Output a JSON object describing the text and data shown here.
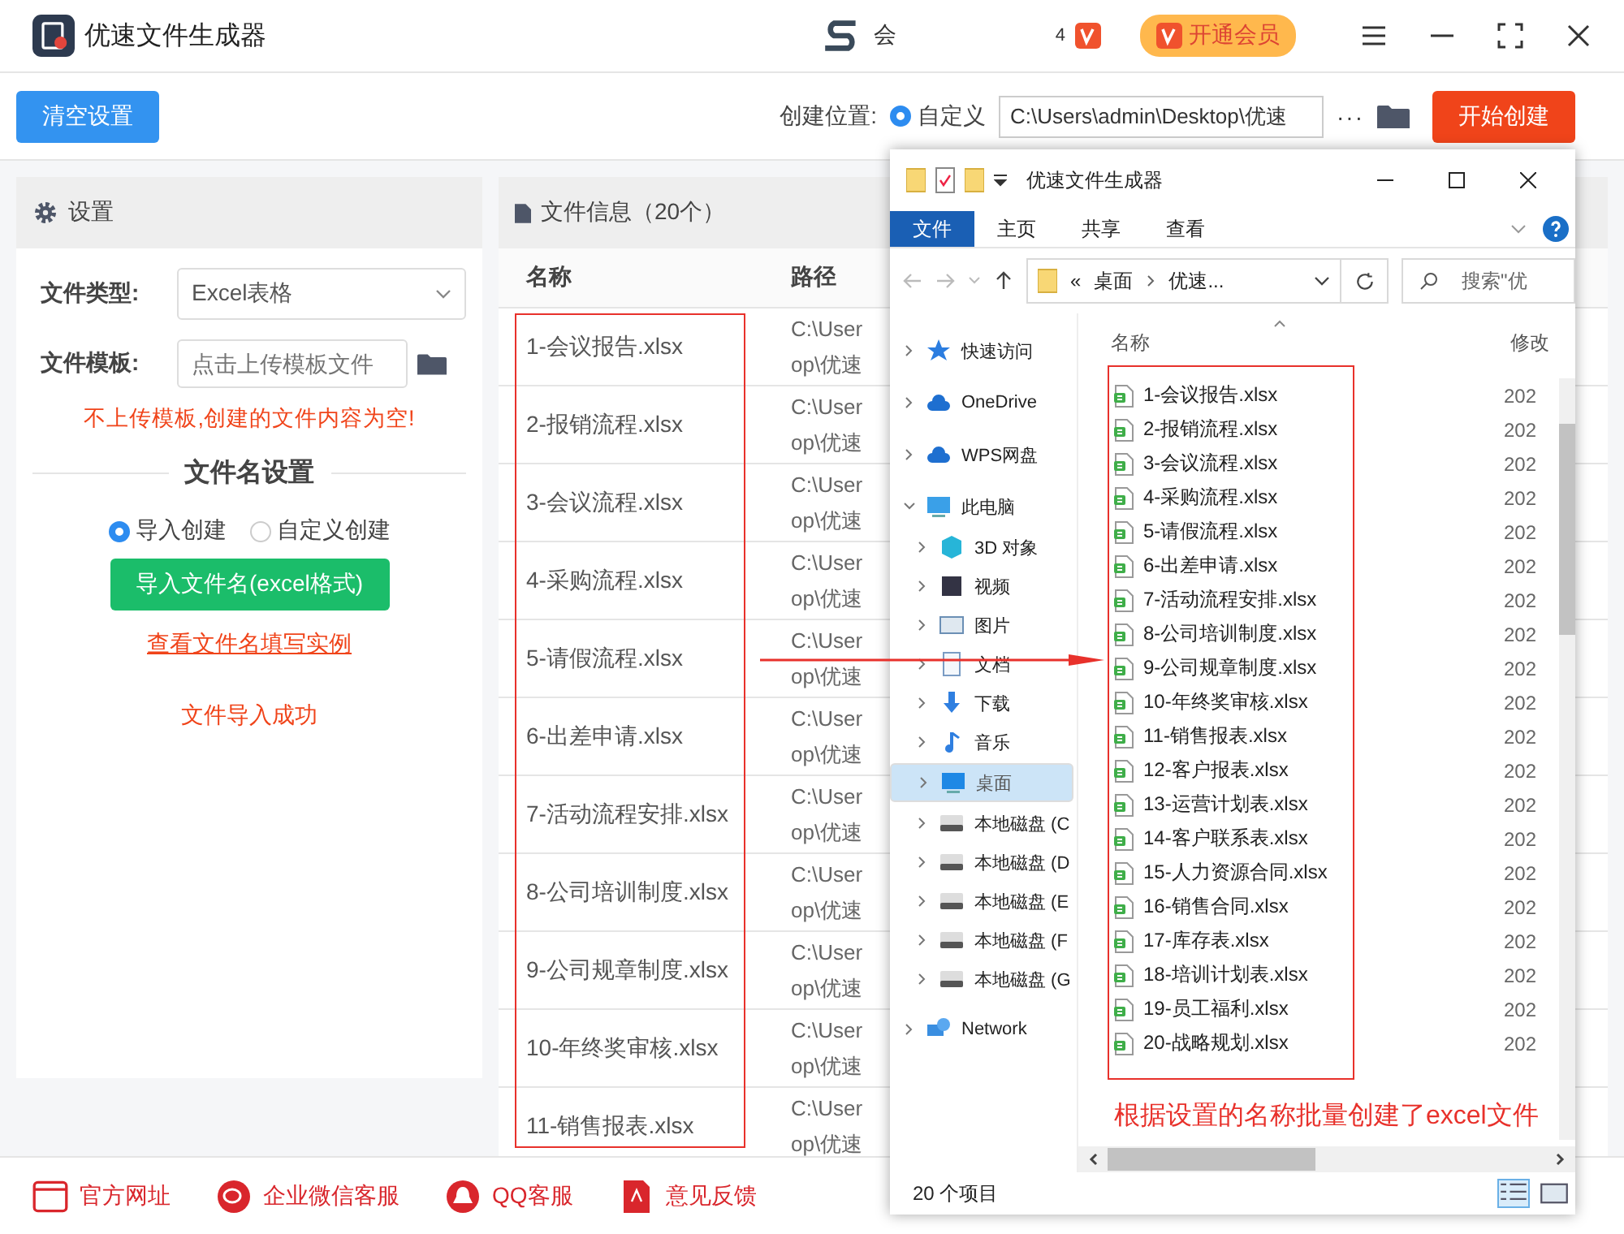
{
  "app": {
    "title": "优速文件生成器",
    "promo_text": "会",
    "promo_num": "4",
    "vip_button": "开通会员"
  },
  "toolbar": {
    "clear_button": "清空设置",
    "location_label": "创建位置:",
    "location_radio": {
      "label": "自定义",
      "selected": true
    },
    "path_value": "C:\\Users\\admin\\Desktop\\优速",
    "more": "···",
    "start_button": "开始创建"
  },
  "settings": {
    "title": "设置",
    "type_label": "文件类型:",
    "type_value": "Excel表格",
    "template_label": "文件模板:",
    "template_placeholder": "点击上传模板文件",
    "warning": "不上传模板,创建的文件内容为空!",
    "section_title": "文件名设置",
    "modes": [
      {
        "label": "导入创建",
        "selected": true
      },
      {
        "label": "自定义创建",
        "selected": false
      }
    ],
    "import_button": "导入文件名(excel格式)",
    "example_link": "查看文件名填写实例",
    "status": "文件导入成功"
  },
  "file_info": {
    "title": "文件信息（20个）",
    "columns": [
      "名称",
      "路径"
    ],
    "rows": [
      {
        "name": "1-会议报告.xlsx",
        "path": [
          "C:\\User",
          "op\\优速"
        ]
      },
      {
        "name": "2-报销流程.xlsx",
        "path": [
          "C:\\User",
          "op\\优速"
        ]
      },
      {
        "name": "3-会议流程.xlsx",
        "path": [
          "C:\\User",
          "op\\优速"
        ]
      },
      {
        "name": "4-采购流程.xlsx",
        "path": [
          "C:\\User",
          "op\\优速"
        ]
      },
      {
        "name": "5-请假流程.xlsx",
        "path": [
          "C:\\User",
          "op\\优速"
        ]
      },
      {
        "name": "6-出差申请.xlsx",
        "path": [
          "C:\\User",
          "op\\优速"
        ]
      },
      {
        "name": "7-活动流程安排.xlsx",
        "path": [
          "C:\\User",
          "op\\优速"
        ]
      },
      {
        "name": "8-公司培训制度.xlsx",
        "path": [
          "C:\\User",
          "op\\优速"
        ]
      },
      {
        "name": "9-公司规章制度.xlsx",
        "path": [
          "C:\\User",
          "op\\优速"
        ]
      },
      {
        "name": "10-年终奖审核.xlsx",
        "path": [
          "C:\\User",
          "op\\优速"
        ]
      },
      {
        "name": "11-销售报表.xlsx",
        "path": [
          "C:\\User",
          "op\\优速"
        ]
      }
    ]
  },
  "footer": [
    {
      "kind": "web",
      "label": "官方网址"
    },
    {
      "kind": "chat",
      "label": "企业微信客服"
    },
    {
      "kind": "qq",
      "label": "QQ客服"
    },
    {
      "kind": "feedback",
      "label": "意见反馈"
    }
  ],
  "explorer": {
    "title": "优速文件生成器",
    "ribbon_tabs": [
      {
        "label": "文件",
        "selected": true
      },
      {
        "label": "主页",
        "selected": false
      },
      {
        "label": "共享",
        "selected": false
      },
      {
        "label": "查看",
        "selected": false
      }
    ],
    "breadcrumb": [
      "«",
      "桌面",
      "优速..."
    ],
    "search_placeholder": "搜索\"优",
    "nav": [
      {
        "kind": "star",
        "label": "快速访问",
        "expanded": false,
        "selected": false
      },
      {
        "kind": "cloud",
        "label": "OneDrive",
        "expanded": false,
        "selected": false
      },
      {
        "kind": "cloud",
        "label": "WPS网盘",
        "expanded": false,
        "selected": false
      },
      {
        "kind": "pc",
        "label": "此电脑",
        "expanded": true,
        "selected": false,
        "children": [
          {
            "kind": "cube",
            "label": "3D 对象",
            "expanded": false,
            "selected": false
          },
          {
            "kind": "video",
            "label": "视频",
            "expanded": false,
            "selected": false
          },
          {
            "kind": "image",
            "label": "图片",
            "expanded": false,
            "selected": false
          },
          {
            "kind": "doc",
            "label": "文档",
            "expanded": false,
            "selected": false
          },
          {
            "kind": "download",
            "label": "下载",
            "expanded": false,
            "selected": false
          },
          {
            "kind": "music",
            "label": "音乐",
            "expanded": false,
            "selected": false
          },
          {
            "kind": "desktop",
            "label": "桌面",
            "expanded": false,
            "selected": true
          },
          {
            "kind": "drive",
            "label": "本地磁盘 (C",
            "expanded": false,
            "selected": false
          },
          {
            "kind": "drive",
            "label": "本地磁盘 (D",
            "expanded": false,
            "selected": false
          },
          {
            "kind": "drive",
            "label": "本地磁盘 (E",
            "expanded": false,
            "selected": false
          },
          {
            "kind": "drive",
            "label": "本地磁盘 (F",
            "expanded": false,
            "selected": false
          },
          {
            "kind": "drive",
            "label": "本地磁盘 (G",
            "expanded": false,
            "selected": false
          }
        ]
      },
      {
        "kind": "network",
        "label": "Network",
        "expanded": false,
        "selected": false
      }
    ],
    "columns": [
      "名称",
      "修改"
    ],
    "files": [
      {
        "name": "1-会议报告.xlsx",
        "date": "202"
      },
      {
        "name": "2-报销流程.xlsx",
        "date": "202"
      },
      {
        "name": "3-会议流程.xlsx",
        "date": "202"
      },
      {
        "name": "4-采购流程.xlsx",
        "date": "202"
      },
      {
        "name": "5-请假流程.xlsx",
        "date": "202"
      },
      {
        "name": "6-出差申请.xlsx",
        "date": "202"
      },
      {
        "name": "7-活动流程安排.xlsx",
        "date": "202"
      },
      {
        "name": "8-公司培训制度.xlsx",
        "date": "202"
      },
      {
        "name": "9-公司规章制度.xlsx",
        "date": "202"
      },
      {
        "name": "10-年终奖审核.xlsx",
        "date": "202"
      },
      {
        "name": "11-销售报表.xlsx",
        "date": "202"
      },
      {
        "name": "12-客户报表.xlsx",
        "date": "202"
      },
      {
        "name": "13-运营计划表.xlsx",
        "date": "202"
      },
      {
        "name": "14-客户联系表.xlsx",
        "date": "202"
      },
      {
        "name": "15-人力资源合同.xlsx",
        "date": "202"
      },
      {
        "name": "16-销售合同.xlsx",
        "date": "202"
      },
      {
        "name": "17-库存表.xlsx",
        "date": "202"
      },
      {
        "name": "18-培训计划表.xlsx",
        "date": "202"
      },
      {
        "name": "19-员工福利.xlsx",
        "date": "202"
      },
      {
        "name": "20-战略规划.xlsx",
        "date": "202"
      }
    ],
    "annotation": "根据设置的名称批量创建了excel文件",
    "status": "20 个项目"
  }
}
